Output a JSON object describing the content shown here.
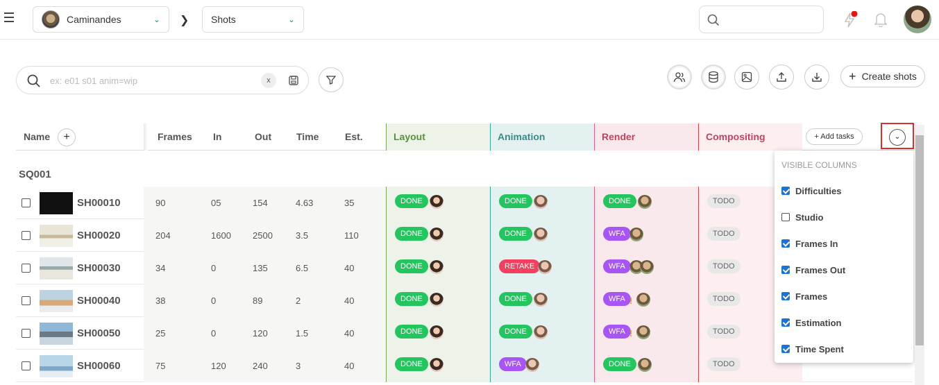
{
  "header": {
    "production": "Caminandes",
    "section": "Shots"
  },
  "search": {
    "placeholder": "ex: e01 s01 anim=wip",
    "clear_label": "x"
  },
  "toolbar": {
    "create_label": "Create shots"
  },
  "table": {
    "headers": {
      "name": "Name",
      "frames": "Frames",
      "in": "In",
      "out": "Out",
      "time": "Time",
      "est": "Est.",
      "add_tasks": "Add tasks"
    },
    "task_columns": [
      {
        "label": "Layout",
        "color": "#5a8f3c",
        "bg": "#eef3ea",
        "border": "#7aa85a"
      },
      {
        "label": "Animation",
        "color": "#3a8a8a",
        "bg": "#e4f1f1",
        "border": "#3aa0a0"
      },
      {
        "label": "Render",
        "color": "#c84060",
        "bg": "#f9e8ec",
        "border": "#e06080"
      },
      {
        "label": "Compositing",
        "color": "#c84060",
        "bg": "#fdeff0",
        "border": "#e04040"
      }
    ],
    "sequence": "SQ001",
    "rows": [
      {
        "name": "SH00010",
        "frames": "90",
        "in": "05",
        "out": "154",
        "time": "4.63",
        "est": "35",
        "tasks": [
          {
            "s": "DONE",
            "a": 1
          },
          {
            "s": "DONE",
            "a": 1
          },
          {
            "s": "DONE",
            "a": 1
          },
          {
            "s": "TODO",
            "a": 0
          }
        ]
      },
      {
        "name": "SH00020",
        "frames": "204",
        "in": "1600",
        "out": "2500",
        "time": "3.5",
        "est": "110",
        "tasks": [
          {
            "s": "DONE",
            "a": 1
          },
          {
            "s": "DONE",
            "a": 1
          },
          {
            "s": "WFA",
            "a": 1
          },
          {
            "s": "TODO",
            "a": 0
          }
        ]
      },
      {
        "name": "SH00030",
        "frames": "34",
        "in": "0",
        "out": "135",
        "time": "6.5",
        "est": "40",
        "tasks": [
          {
            "s": "DONE",
            "a": 1
          },
          {
            "s": "RETAKE",
            "a": 1
          },
          {
            "s": "WFA",
            "a": 2
          },
          {
            "s": "TODO",
            "a": 0
          }
        ]
      },
      {
        "name": "SH00040",
        "frames": "38",
        "in": "0",
        "out": "89",
        "time": "2",
        "est": "40",
        "tasks": [
          {
            "s": "DONE",
            "a": 1
          },
          {
            "s": "DONE",
            "a": 1
          },
          {
            "s": "WFA",
            "a": 1,
            "excl": "!"
          },
          {
            "s": "TODO",
            "a": 0
          }
        ]
      },
      {
        "name": "SH00050",
        "frames": "25",
        "in": "0",
        "out": "120",
        "time": "1.5",
        "est": "40",
        "tasks": [
          {
            "s": "DONE",
            "a": 1
          },
          {
            "s": "DONE",
            "a": 1
          },
          {
            "s": "WFA",
            "a": 1,
            "excl": "!"
          },
          {
            "s": "TODO",
            "a": 0
          }
        ]
      },
      {
        "name": "SH00060",
        "frames": "75",
        "in": "120",
        "out": "240",
        "time": "3",
        "est": "40",
        "tasks": [
          {
            "s": "DONE",
            "a": 1
          },
          {
            "s": "WFA",
            "a": 1
          },
          {
            "s": "DONE",
            "a": 1
          },
          {
            "s": "TODO",
            "a": 0
          }
        ]
      }
    ]
  },
  "status_colors": {
    "DONE": "#22c55e",
    "WFA": "#a855f7",
    "RETAKE": "#f43f5e",
    "TODO": "#e8e8e8"
  },
  "columns_panel": {
    "title": "VISIBLE COLUMNS",
    "items": [
      {
        "label": "Difficulties",
        "checked": true
      },
      {
        "label": "Studio",
        "checked": false
      },
      {
        "label": "Frames In",
        "checked": true
      },
      {
        "label": "Frames Out",
        "checked": true
      },
      {
        "label": "Frames",
        "checked": true
      },
      {
        "label": "Estimation",
        "checked": true
      },
      {
        "label": "Time Spent",
        "checked": true
      }
    ]
  }
}
